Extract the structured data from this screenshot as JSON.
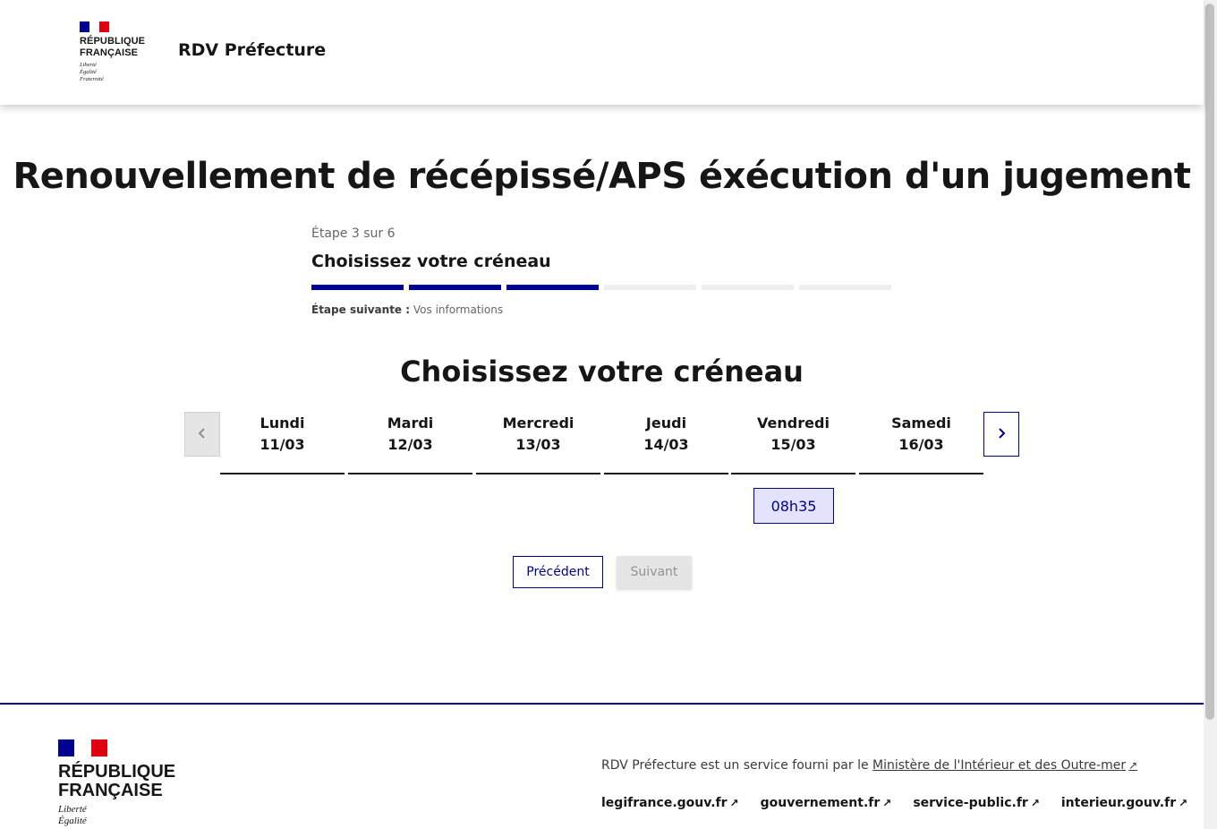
{
  "header": {
    "republique": [
      "RÉPUBLIQUE",
      "FRANÇAISE"
    ],
    "devise": [
      "Liberté",
      "Égalité",
      "Fraternité"
    ],
    "service_title": "RDV Préfecture"
  },
  "page": {
    "title": "Renouvellement de récépissé/APS éxécution d'un jugement"
  },
  "stepper": {
    "step_count": "Étape 3 sur 6",
    "step_title": "Choisissez votre créneau",
    "current_step": 3,
    "total_steps": 6,
    "next_label": "Étape suivante :",
    "next_value": "Vos informations"
  },
  "calendar": {
    "title": "Choisissez votre créneau",
    "prev_icon": "chevron-left-icon",
    "next_icon": "chevron-right-icon",
    "days": [
      {
        "name": "Lundi",
        "date": "11/03"
      },
      {
        "name": "Mardi",
        "date": "12/03"
      },
      {
        "name": "Mercredi",
        "date": "13/03"
      },
      {
        "name": "Jeudi",
        "date": "14/03"
      },
      {
        "name": "Vendredi",
        "date": "15/03"
      },
      {
        "name": "Samedi",
        "date": "16/03"
      }
    ],
    "slots": [
      {
        "day": "Vendredi",
        "time": "08h35"
      }
    ]
  },
  "actions": {
    "previous": "Précédent",
    "next": "Suivant"
  },
  "footer": {
    "republique": [
      "RÉPUBLIQUE",
      "FRANÇAISE"
    ],
    "devise": [
      "Liberté",
      "Égalité"
    ],
    "desc_prefix": "RDV Préfecture est un service fourni par le",
    "ministry": "Ministère de l'Intérieur et des Outre-mer",
    "links": [
      "legifrance.gouv.fr",
      "gouvernement.fr",
      "service-public.fr",
      "interieur.gouv.fr"
    ]
  },
  "colors": {
    "primary": "#000091",
    "slot_bg": "#e3e3fd",
    "disabled_bg": "#e5e5e5",
    "flag_red": "#e1000f"
  }
}
